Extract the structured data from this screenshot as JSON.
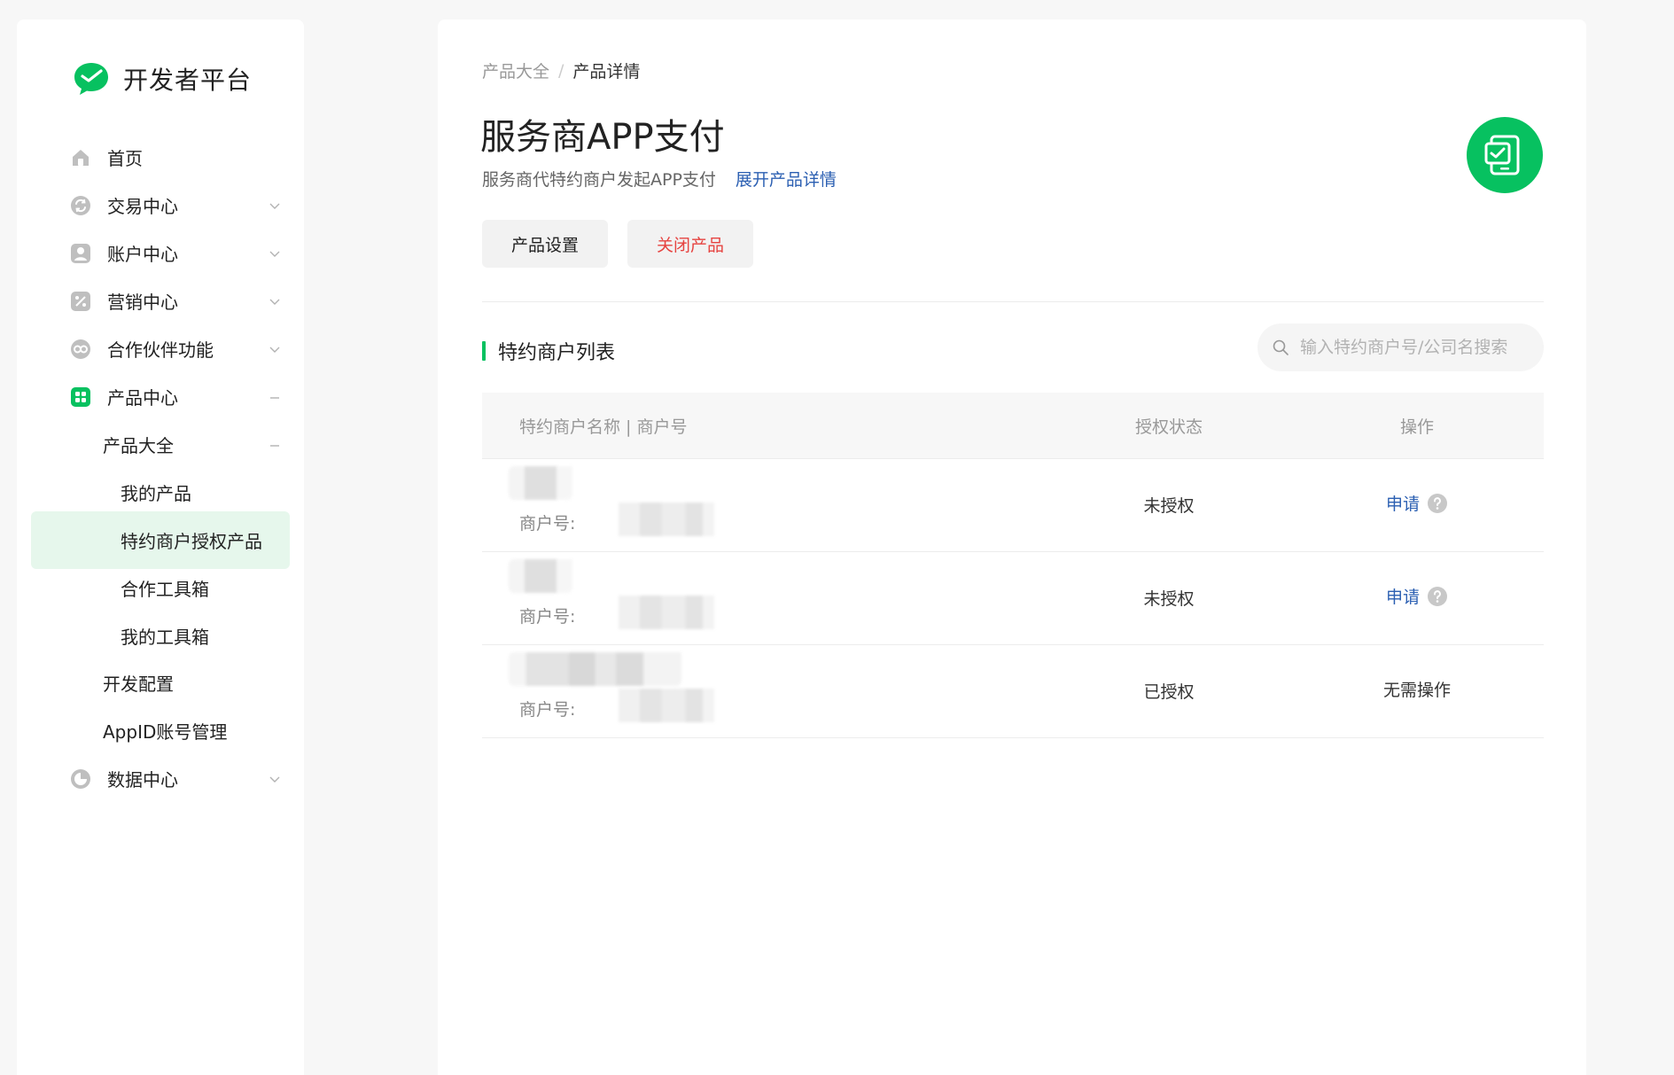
{
  "brand": {
    "title": "开发者平台"
  },
  "sidebar": {
    "items": [
      {
        "label": "首页"
      },
      {
        "label": "交易中心"
      },
      {
        "label": "账户中心"
      },
      {
        "label": "营销中心"
      },
      {
        "label": "合作伙伴功能"
      },
      {
        "label": "产品中心"
      },
      {
        "label": "产品大全"
      },
      {
        "label": "我的产品"
      },
      {
        "label": "特约商户授权产品"
      },
      {
        "label": "合作工具箱"
      },
      {
        "label": "我的工具箱"
      },
      {
        "label": "开发配置"
      },
      {
        "label": "AppID账号管理"
      },
      {
        "label": "数据中心"
      }
    ]
  },
  "breadcrumb": {
    "prev": "产品大全",
    "sep": "/",
    "current": "产品详情"
  },
  "product": {
    "title": "服务商APP支付",
    "description": "服务商代特约商户发起APP支付",
    "expand_link": "展开产品详情"
  },
  "actions": {
    "settings_label": "产品设置",
    "close_label": "关闭产品"
  },
  "section": {
    "title": "特约商户列表"
  },
  "search": {
    "placeholder": "输入特约商户号/公司名搜索"
  },
  "table": {
    "headers": {
      "name": "特约商户名称 | 商户号",
      "status": "授权状态",
      "action": "操作"
    },
    "merchant_no_label": "商户号:",
    "rows": [
      {
        "status": "未授权",
        "action": "申请"
      },
      {
        "status": "未授权",
        "action": "申请"
      },
      {
        "status": "已授权",
        "action": "无需操作"
      }
    ]
  },
  "colors": {
    "brand_green": "#07c160",
    "link_blue": "#2b5fb2",
    "danger_red": "#e64340",
    "active_bg": "#e6f7ec"
  }
}
